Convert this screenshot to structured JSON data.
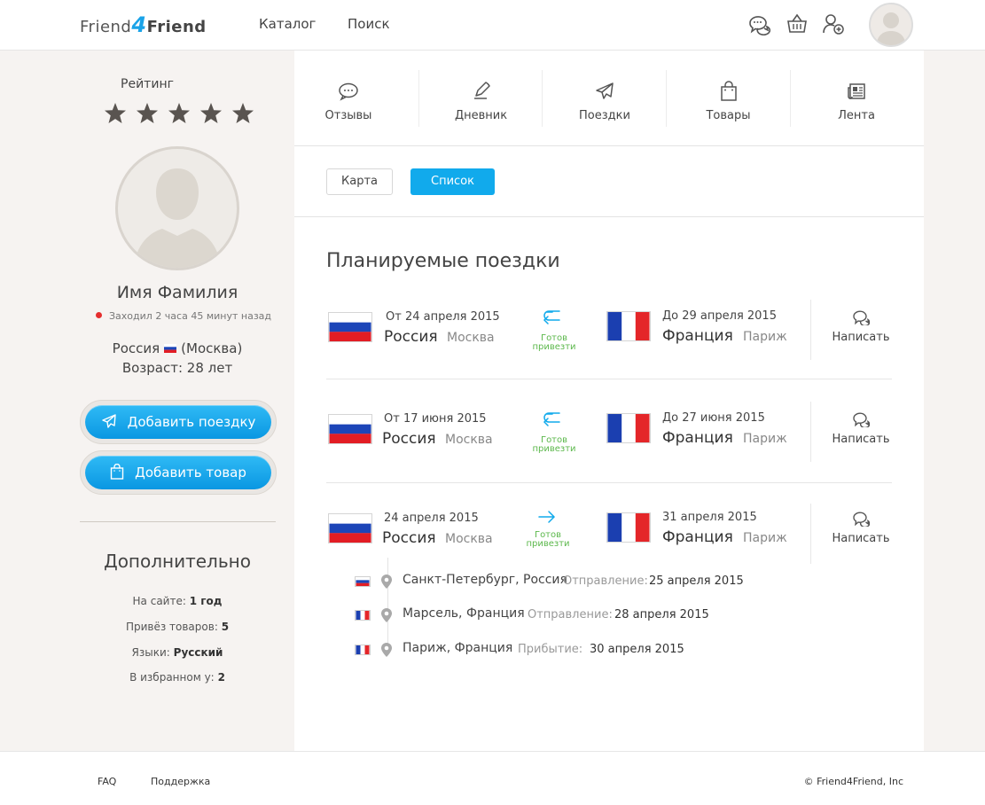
{
  "header": {
    "logo_part1": "Friend",
    "logo_part2": "4",
    "logo_part3": "Friend",
    "nav": [
      "Каталог",
      "Поиск"
    ],
    "icons": [
      "chat-icon",
      "basket-icon",
      "add-user-icon"
    ]
  },
  "sidebar": {
    "rating_label": "Рейтинг",
    "stars": 5,
    "user_name": "Имя Фамилия",
    "status": "Заходил 2 часа 45 минут назад",
    "country": "Россия",
    "city": "(Москва)",
    "age": "Возраст: 28 лет",
    "add_trip_label": "Добавить поездку",
    "add_item_label": "Добавить товар",
    "extra_title": "Дополнительно",
    "extra": [
      {
        "label": "На сайте:",
        "value": "1 год"
      },
      {
        "label": "Привёз товаров:",
        "value": "5"
      },
      {
        "label": "Языки:",
        "value": "Русский"
      },
      {
        "label": "В избранном у:",
        "value": "2"
      }
    ]
  },
  "tabs": [
    {
      "label": "Отзывы",
      "icon": "reviews-icon"
    },
    {
      "label": "Дневник",
      "icon": "diary-icon"
    },
    {
      "label": "Поездки",
      "icon": "plane-icon"
    },
    {
      "label": "Товары",
      "icon": "bag-icon"
    },
    {
      "label": "Лента",
      "icon": "newspaper-icon"
    }
  ],
  "view": {
    "map_label": "Карта",
    "list_label": "Список"
  },
  "section_title": "Планируемые поездки",
  "trips": [
    {
      "from_date": "От 24 апреля 2015",
      "from_country": "Россия",
      "from_city": "Москва",
      "ready_line1": "Готов",
      "ready_line2": "привезти",
      "round_trip": true,
      "to_date": "До 29 апреля 2015",
      "to_country": "Франция",
      "to_city": "Париж",
      "write_label": "Написать"
    },
    {
      "from_date": "От 17 июня 2015",
      "from_country": "Россия",
      "from_city": "Москва",
      "ready_line1": "Готов",
      "ready_line2": "привезти",
      "round_trip": true,
      "to_date": "До 27 июня 2015",
      "to_country": "Франция",
      "to_city": "Париж",
      "write_label": "Написать"
    },
    {
      "from_date": "24 апреля 2015",
      "from_country": "Россия",
      "from_city": "Москва",
      "ready_line1": "Готов",
      "ready_line2": "привезти",
      "round_trip": false,
      "to_date": "31 апреля 2015",
      "to_country": "Франция",
      "to_city": "Париж",
      "write_label": "Написать"
    }
  ],
  "route_stops": [
    {
      "flag": "ru",
      "name": "Санкт-Петербург, Россия",
      "label": "Отправление:",
      "date": "25 апреля 2015"
    },
    {
      "flag": "fr",
      "name": "Марсель, Франция",
      "label": "Отправление:",
      "date": "28 апреля 2015"
    },
    {
      "flag": "fr",
      "name": "Париж, Франция",
      "label": "Прибытие:",
      "date": "30 апреля 2015"
    }
  ],
  "footer": {
    "faq": "FAQ",
    "support": "Поддержка",
    "copyright": "© Friend4Friend, Inc"
  },
  "colors": {
    "accent": "#11aaec",
    "ready": "#5cb84c",
    "sidebar_bg": "#f6f3f1",
    "status_dot": "#e52e2e"
  }
}
